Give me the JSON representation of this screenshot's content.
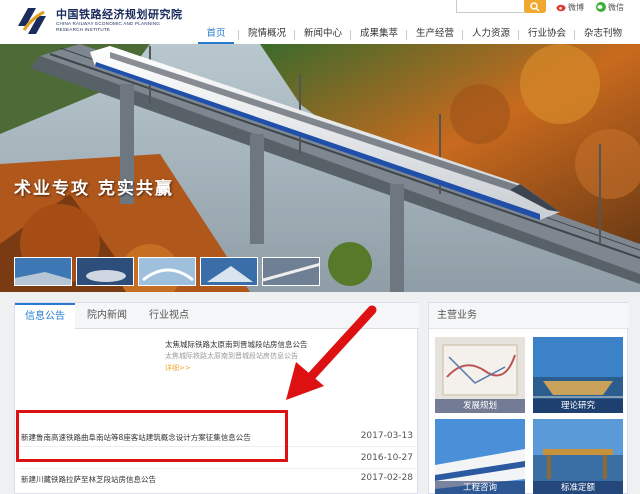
{
  "header": {
    "org_name_cn": "中国铁路经济规划研究院",
    "org_name_en": "CHINA RAILWAY ECONOMIC AND PLANNING RESEARCH INSTITUTE",
    "weibo_label": "微博",
    "wechat_label": "微信",
    "search_placeholder": ""
  },
  "nav": {
    "items": [
      {
        "label": "首页"
      },
      {
        "label": "院情概况"
      },
      {
        "label": "新闻中心"
      },
      {
        "label": "成果集萃"
      },
      {
        "label": "生产经营"
      },
      {
        "label": "人力资源"
      },
      {
        "label": "行业协会"
      },
      {
        "label": "杂志刊物"
      }
    ]
  },
  "hero": {
    "slogan": "术业专攻 克实共赢"
  },
  "news_panel": {
    "tabs": [
      {
        "label": "信息公告"
      },
      {
        "label": "院内新闻"
      },
      {
        "label": "行业视点"
      }
    ],
    "featured": {
      "title": "太焦城际铁路太原南到晋城段站房信息公告",
      "desc": "太焦城际铁路太原南到晋城段站房信息公告",
      "more": "详细>>"
    },
    "rows": [
      {
        "title": "新建鲁南高速铁路曲阜南站等8座客站建筑概念设计方案征集信息公告",
        "date": "2017-03-13"
      },
      {
        "title": "",
        "date": "2016-10-27"
      },
      {
        "title": "新建川藏铁路拉萨至林芝段站房信息公告",
        "date": "2017-02-28"
      }
    ]
  },
  "business_panel": {
    "title": "主营业务",
    "items": [
      {
        "label": "发展规划"
      },
      {
        "label": "理论研究"
      },
      {
        "label": "工程咨询"
      },
      {
        "label": "标准定额"
      }
    ]
  },
  "colors": {
    "accent": "#2a7bd0",
    "search_button": "#f0a82e",
    "highlight": "#dd1111"
  }
}
